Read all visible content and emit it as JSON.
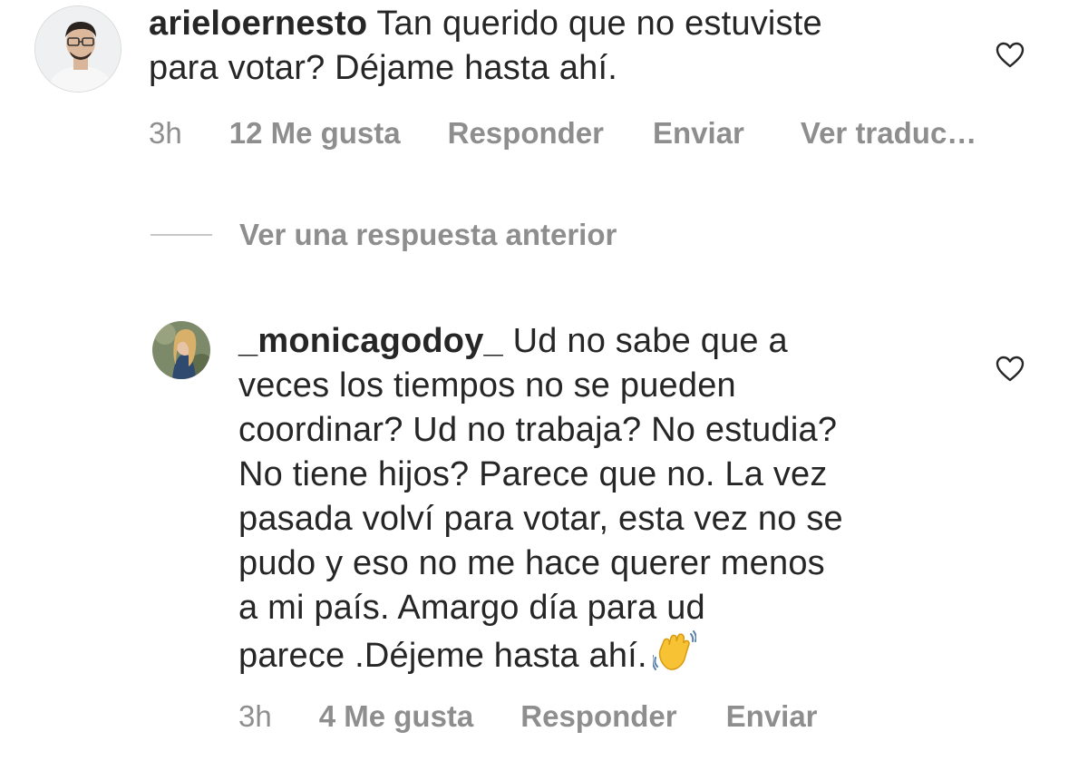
{
  "comments": [
    {
      "username": "arieloernesto",
      "text": " Tan querido que no estuviste\npara votar? Déjame hasta ahí.",
      "time": "3h",
      "likes": "12 Me gusta",
      "reply": "Responder",
      "send": "Enviar",
      "translate": "Ver traduc…",
      "avatar_icon": "profile-avatar-man-glasses",
      "like_icon": "heart-outline-icon"
    },
    {
      "username": "_monicagodoy_",
      "text": " Ud no sabe que a\nveces los tiempos no se pueden\ncoordinar? Ud no trabaja? No estudia?\nNo tiene hijos? Parece que no. La vez\npasada volví para votar, esta vez no se\npudo y eso no me hace querer menos\na mi país. Amargo día para ud\nparece .Déjeme hasta ahí.",
      "emoji": "waving-hand-emoji",
      "time": "3h",
      "likes": "4 Me gusta",
      "reply": "Responder",
      "send": "Enviar",
      "avatar_icon": "profile-avatar-woman",
      "like_icon": "heart-outline-icon"
    }
  ],
  "view_replies": {
    "label": "Ver una respuesta anterior"
  },
  "colors": {
    "text": "#262626",
    "secondary": "#8e8e8e",
    "divider": "#c7c7c7",
    "background": "#ffffff"
  }
}
